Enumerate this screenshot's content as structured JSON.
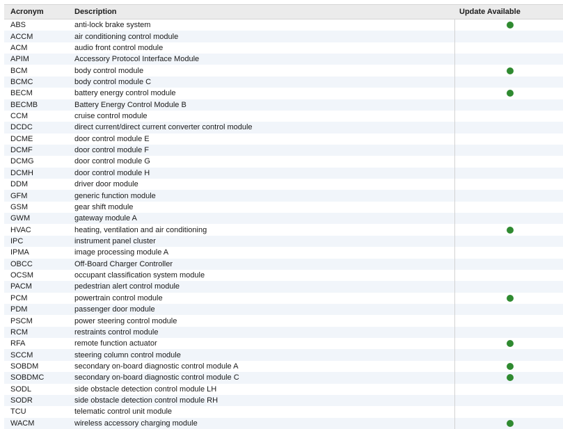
{
  "columns": {
    "acronym": "Acronym",
    "description": "Description",
    "update": "Update Available"
  },
  "colors": {
    "update_dot": "#2f8a30",
    "stripe": "#f1f5fa",
    "header_bg": "#ebebeb"
  },
  "rows": [
    {
      "acronym": "ABS",
      "description": "anti-lock brake system",
      "update": true
    },
    {
      "acronym": "ACCM",
      "description": "air conditioning control module",
      "update": false
    },
    {
      "acronym": "ACM",
      "description": "audio front control module",
      "update": false
    },
    {
      "acronym": "APIM",
      "description": "Accessory Protocol Interface Module",
      "update": false
    },
    {
      "acronym": "BCM",
      "description": "body control module",
      "update": true
    },
    {
      "acronym": "BCMC",
      "description": "body control module C",
      "update": false
    },
    {
      "acronym": "BECM",
      "description": "battery energy control module",
      "update": true
    },
    {
      "acronym": "BECMB",
      "description": "Battery Energy Control Module B",
      "update": false
    },
    {
      "acronym": "CCM",
      "description": "cruise control module",
      "update": false
    },
    {
      "acronym": "DCDC",
      "description": "direct current/direct current converter control module",
      "update": false
    },
    {
      "acronym": "DCME",
      "description": "door control module E",
      "update": false
    },
    {
      "acronym": "DCMF",
      "description": "door control module F",
      "update": false
    },
    {
      "acronym": "DCMG",
      "description": "door control module G",
      "update": false
    },
    {
      "acronym": "DCMH",
      "description": "door control module H",
      "update": false
    },
    {
      "acronym": "DDM",
      "description": "driver door module",
      "update": false
    },
    {
      "acronym": "GFM",
      "description": "generic function module",
      "update": false
    },
    {
      "acronym": "GSM",
      "description": "gear shift module",
      "update": false
    },
    {
      "acronym": "GWM",
      "description": "gateway module A",
      "update": false
    },
    {
      "acronym": "HVAC",
      "description": "heating, ventilation and air conditioning",
      "update": true
    },
    {
      "acronym": "IPC",
      "description": "instrument panel cluster",
      "update": false
    },
    {
      "acronym": "IPMA",
      "description": "image processing module A",
      "update": false
    },
    {
      "acronym": "OBCC",
      "description": "Off-Board Charger Controller",
      "update": false
    },
    {
      "acronym": "OCSM",
      "description": "occupant classification system module",
      "update": false
    },
    {
      "acronym": "PACM",
      "description": "pedestrian alert control module",
      "update": false
    },
    {
      "acronym": "PCM",
      "description": "powertrain control module",
      "update": true
    },
    {
      "acronym": "PDM",
      "description": "passenger door module",
      "update": false
    },
    {
      "acronym": "PSCM",
      "description": "power steering control module",
      "update": false
    },
    {
      "acronym": "RCM",
      "description": "restraints control module",
      "update": false
    },
    {
      "acronym": "RFA",
      "description": "remote function actuator",
      "update": true
    },
    {
      "acronym": "SCCM",
      "description": "steering column control module",
      "update": false
    },
    {
      "acronym": "SOBDM",
      "description": "secondary on-board diagnostic control module A",
      "update": true
    },
    {
      "acronym": "SOBDMC",
      "description": "secondary on-board diagnostic control module C",
      "update": true
    },
    {
      "acronym": "SODL",
      "description": "side obstacle detection control module LH",
      "update": false
    },
    {
      "acronym": "SODR",
      "description": "side obstacle detection control module RH",
      "update": false
    },
    {
      "acronym": "TCU",
      "description": "telematic control unit module",
      "update": false
    },
    {
      "acronym": "WACM",
      "description": "wireless accessory charging module",
      "update": true
    }
  ]
}
